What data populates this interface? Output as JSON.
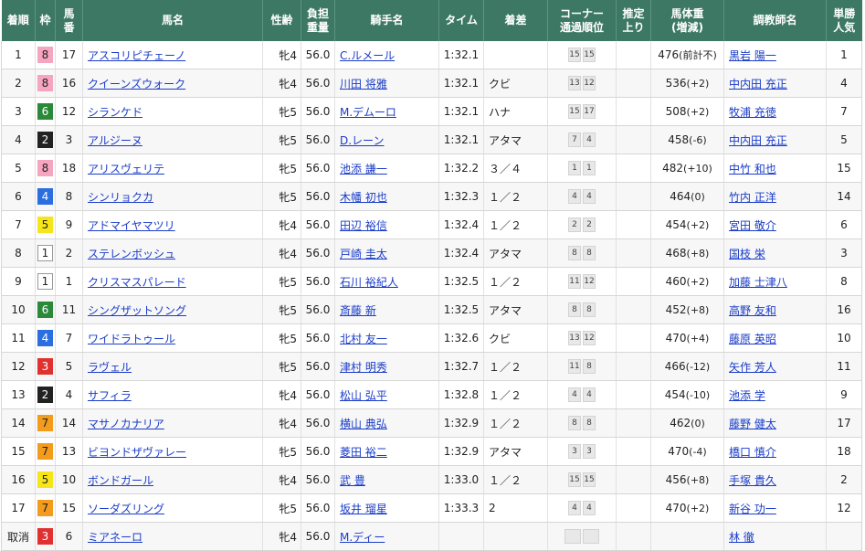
{
  "headers": {
    "rank": "着順",
    "waku": "枠",
    "umaban": "馬\n番",
    "horse": "馬名",
    "sexage": "性齢",
    "weight_carried": "負担\n重量",
    "jockey": "騎手名",
    "time": "タイム",
    "margin": "着差",
    "corner": "コーナー\n通過順位",
    "last3f": "推定\n上り",
    "horse_weight": "馬体重\n(増減)",
    "trainer": "調教師名",
    "popularity": "単勝\n人気"
  },
  "rows": [
    {
      "rank": "1",
      "waku": "8",
      "umaban": "17",
      "horse": "アスコリピチェーノ",
      "sexage": "牝4",
      "load": "56.0",
      "jockey": "C.ルメール",
      "time": "1:32.1",
      "margin": "",
      "corners": [
        "15",
        "15"
      ],
      "last3f": "",
      "weight": "476",
      "diff": "(前計不)",
      "trainer": "黒岩 陽一",
      "pop": "1"
    },
    {
      "rank": "2",
      "waku": "8",
      "umaban": "16",
      "horse": "クイーンズウォーク",
      "sexage": "牝4",
      "load": "56.0",
      "jockey": "川田 将雅",
      "time": "1:32.1",
      "margin": "クビ",
      "corners": [
        "13",
        "12"
      ],
      "last3f": "",
      "weight": "536",
      "diff": "(+2)",
      "trainer": "中内田 充正",
      "pop": "4"
    },
    {
      "rank": "3",
      "waku": "6",
      "umaban": "12",
      "horse": "シランケド",
      "sexage": "牝5",
      "load": "56.0",
      "jockey": "M.デムーロ",
      "time": "1:32.1",
      "margin": "ハナ",
      "corners": [
        "15",
        "17"
      ],
      "last3f": "",
      "weight": "508",
      "diff": "(+2)",
      "trainer": "牧浦 充徳",
      "pop": "7"
    },
    {
      "rank": "4",
      "waku": "2",
      "umaban": "3",
      "horse": "アルジーヌ",
      "sexage": "牝5",
      "load": "56.0",
      "jockey": "D.レーン",
      "time": "1:32.1",
      "margin": "アタマ",
      "corners": [
        "7",
        "4"
      ],
      "last3f": "",
      "weight": "458",
      "diff": "(-6)",
      "trainer": "中内田 充正",
      "pop": "5"
    },
    {
      "rank": "5",
      "waku": "8",
      "umaban": "18",
      "horse": "アリスヴェリテ",
      "sexage": "牝5",
      "load": "56.0",
      "jockey": "池添 謙一",
      "time": "1:32.2",
      "margin": "３／４",
      "corners": [
        "1",
        "1"
      ],
      "last3f": "",
      "weight": "482",
      "diff": "(+10)",
      "trainer": "中竹 和也",
      "pop": "15"
    },
    {
      "rank": "6",
      "waku": "4",
      "umaban": "8",
      "horse": "シンリョクカ",
      "sexage": "牝5",
      "load": "56.0",
      "jockey": "木幡 初也",
      "time": "1:32.3",
      "margin": "１／２",
      "corners": [
        "4",
        "4"
      ],
      "last3f": "",
      "weight": "464",
      "diff": "(0)",
      "trainer": "竹内 正洋",
      "pop": "14"
    },
    {
      "rank": "7",
      "waku": "5",
      "umaban": "9",
      "horse": "アドマイヤマツリ",
      "sexage": "牝4",
      "load": "56.0",
      "jockey": "田辺 裕信",
      "time": "1:32.4",
      "margin": "１／２",
      "corners": [
        "2",
        "2"
      ],
      "last3f": "",
      "weight": "454",
      "diff": "(+2)",
      "trainer": "宮田 敬介",
      "pop": "6"
    },
    {
      "rank": "8",
      "waku": "1",
      "umaban": "2",
      "horse": "ステレンボッシュ",
      "sexage": "牝4",
      "load": "56.0",
      "jockey": "戸崎 圭太",
      "time": "1:32.4",
      "margin": "アタマ",
      "corners": [
        "8",
        "8"
      ],
      "last3f": "",
      "weight": "468",
      "diff": "(+8)",
      "trainer": "国枝 栄",
      "pop": "3"
    },
    {
      "rank": "9",
      "waku": "1",
      "umaban": "1",
      "horse": "クリスマスパレード",
      "sexage": "牝5",
      "load": "56.0",
      "jockey": "石川 裕紀人",
      "time": "1:32.5",
      "margin": "１／２",
      "corners": [
        "11",
        "12"
      ],
      "last3f": "",
      "weight": "460",
      "diff": "(+2)",
      "trainer": "加藤 士津八",
      "pop": "8"
    },
    {
      "rank": "10",
      "waku": "6",
      "umaban": "11",
      "horse": "シングザットソング",
      "sexage": "牝5",
      "load": "56.0",
      "jockey": "斎藤 新",
      "time": "1:32.5",
      "margin": "アタマ",
      "corners": [
        "8",
        "8"
      ],
      "last3f": "",
      "weight": "452",
      "diff": "(+8)",
      "trainer": "高野 友和",
      "pop": "16"
    },
    {
      "rank": "11",
      "waku": "4",
      "umaban": "7",
      "horse": "ワイドラトゥール",
      "sexage": "牝5",
      "load": "56.0",
      "jockey": "北村 友一",
      "time": "1:32.6",
      "margin": "クビ",
      "corners": [
        "13",
        "12"
      ],
      "last3f": "",
      "weight": "470",
      "diff": "(+4)",
      "trainer": "藤原 英昭",
      "pop": "10"
    },
    {
      "rank": "12",
      "waku": "3",
      "umaban": "5",
      "horse": "ラヴェル",
      "sexage": "牝5",
      "load": "56.0",
      "jockey": "津村 明秀",
      "time": "1:32.7",
      "margin": "１／２",
      "corners": [
        "11",
        "8"
      ],
      "last3f": "",
      "weight": "466",
      "diff": "(-12)",
      "trainer": "矢作 芳人",
      "pop": "11"
    },
    {
      "rank": "13",
      "waku": "2",
      "umaban": "4",
      "horse": "サフィラ",
      "sexage": "牝4",
      "load": "56.0",
      "jockey": "松山 弘平",
      "time": "1:32.8",
      "margin": "１／２",
      "corners": [
        "4",
        "4"
      ],
      "last3f": "",
      "weight": "454",
      "diff": "(-10)",
      "trainer": "池添 学",
      "pop": "9"
    },
    {
      "rank": "14",
      "waku": "7",
      "umaban": "14",
      "horse": "マサノカナリア",
      "sexage": "牝4",
      "load": "56.0",
      "jockey": "横山 典弘",
      "time": "1:32.9",
      "margin": "１／２",
      "corners": [
        "8",
        "8"
      ],
      "last3f": "",
      "weight": "462",
      "diff": "(0)",
      "trainer": "藤野 健太",
      "pop": "17"
    },
    {
      "rank": "15",
      "waku": "7",
      "umaban": "13",
      "horse": "ビヨンドザヴァレー",
      "sexage": "牝5",
      "load": "56.0",
      "jockey": "菱田 裕二",
      "time": "1:32.9",
      "margin": "アタマ",
      "corners": [
        "3",
        "3"
      ],
      "last3f": "",
      "weight": "470",
      "diff": "(-4)",
      "trainer": "橋口 慎介",
      "pop": "18"
    },
    {
      "rank": "16",
      "waku": "5",
      "umaban": "10",
      "horse": "ボンドガール",
      "sexage": "牝4",
      "load": "56.0",
      "jockey": "武 豊",
      "time": "1:33.0",
      "margin": "１／２",
      "corners": [
        "15",
        "15"
      ],
      "last3f": "",
      "weight": "456",
      "diff": "(+8)",
      "trainer": "手塚 貴久",
      "pop": "2"
    },
    {
      "rank": "17",
      "waku": "7",
      "umaban": "15",
      "horse": "ソーダズリング",
      "sexage": "牝5",
      "load": "56.0",
      "jockey": "坂井 瑠星",
      "time": "1:33.3",
      "margin": "2",
      "corners": [
        "4",
        "4"
      ],
      "last3f": "",
      "weight": "470",
      "diff": "(+2)",
      "trainer": "新谷 功一",
      "pop": "12"
    },
    {
      "rank": "取消",
      "waku": "3",
      "umaban": "6",
      "horse": "ミアネーロ",
      "sexage": "牝4",
      "load": "56.0",
      "jockey": "M.ディー",
      "time": "",
      "margin": "",
      "corners": [
        "",
        ""
      ],
      "last3f": "",
      "weight": "",
      "diff": "",
      "trainer": "林 徹",
      "pop": ""
    }
  ]
}
